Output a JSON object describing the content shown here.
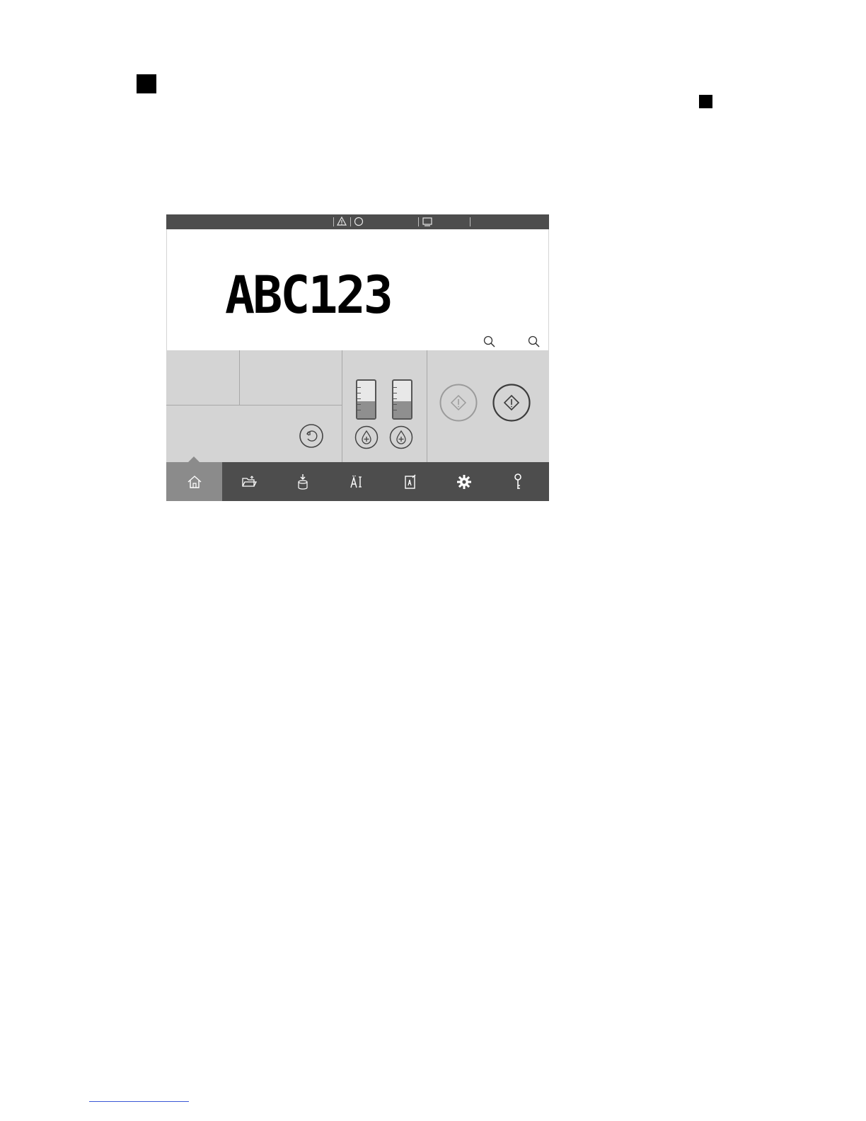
{
  "preview": {
    "message_text": "ABC123"
  },
  "ink_levels": {
    "ink_tank_fill": 0.45,
    "makeup_tank_fill": 0.45
  },
  "nav": {
    "items": [
      "home-icon",
      "folder-icon",
      "download-icon",
      "text-edit-icon",
      "document-check-icon",
      "gear-icon",
      "key-icon"
    ],
    "active": "home-icon"
  },
  "colors": {
    "bar": "#4d4d4d",
    "panel": "#d4d4d4",
    "active_tab": "#8b8b8b",
    "tank_fill": "#8f8f8f"
  }
}
